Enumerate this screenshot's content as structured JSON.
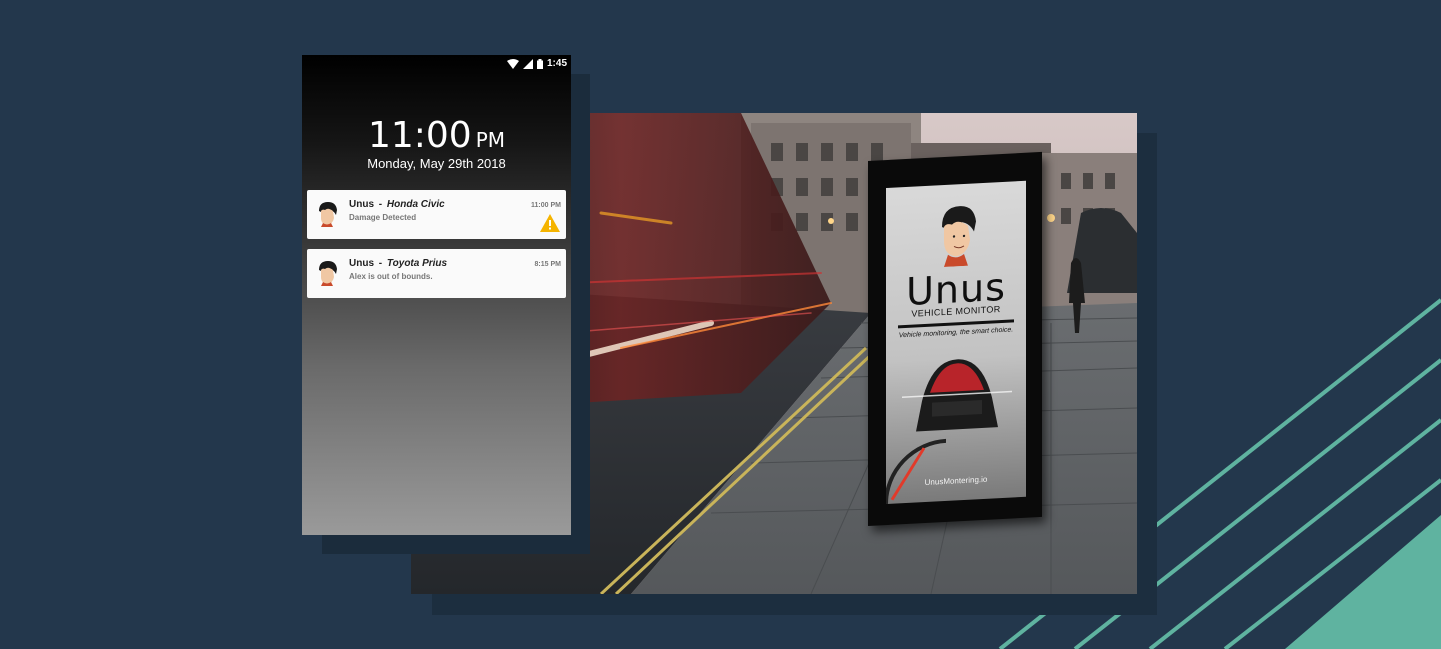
{
  "colors": {
    "background": "#23374c",
    "accent_teal": "#5fb3a0"
  },
  "phone": {
    "status_bar": {
      "icons": [
        "wifi-icon",
        "signal-icon",
        "battery-icon"
      ],
      "time": "1:45"
    },
    "lockscreen": {
      "time": "11:00",
      "ampm": "PM",
      "date": "Monday, May 29th 2018"
    },
    "notifications": [
      {
        "app": "Unus",
        "separator": "-",
        "vehicle": "Honda Civic",
        "message": "Damage Detected",
        "time": "11:00 PM",
        "icon": "warning-icon"
      },
      {
        "app": "Unus",
        "separator": "-",
        "vehicle": "Toyota Prius",
        "message": "Alex is out of bounds.",
        "time": "8:15 PM",
        "icon": null
      }
    ]
  },
  "billboard": {
    "brand": "Unus",
    "subtitle": "VEHICLE MONITOR",
    "tagline": "Vehicle monitoring, the smart choice.",
    "url": "UnusMontering.io"
  }
}
